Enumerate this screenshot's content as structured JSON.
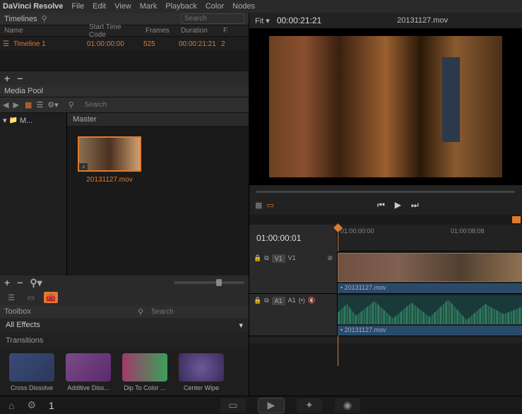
{
  "app_name": "DaVinci Resolve",
  "menu": [
    "File",
    "Edit",
    "View",
    "Mark",
    "Playback",
    "Color",
    "Nodes"
  ],
  "timelines_panel": {
    "title": "Timelines",
    "search_placeholder": "Search",
    "columns": {
      "name": "Name",
      "start": "Start Time Code",
      "frames": "Frames",
      "duration": "Duration",
      "extra": "F"
    },
    "row": {
      "name": "Timeline 1",
      "start": "01:00:00:00",
      "frames": "525",
      "duration": "00:00:21:21",
      "extra": "2"
    }
  },
  "media_pool": {
    "title": "Media Pool",
    "search_placeholder": "Search",
    "tree_root": "M...",
    "breadcrumb": "Master",
    "clip": {
      "name": "20131127.mov"
    }
  },
  "toolbox": {
    "title": "Toolbox",
    "search_placeholder": "Search",
    "filter_label": "All Effects",
    "section_label": "Transitions",
    "items": [
      "Cross Dissolve",
      "Additive Diss...",
      "Dip To Color ...",
      "Center Wipe"
    ]
  },
  "viewer": {
    "fit_label": "Fit",
    "timecode": "00:00:21:21",
    "clip_name": "20131127.mov"
  },
  "timeline": {
    "position_tc": "01:00:00:01",
    "ticks": [
      "01:00:00:00",
      "01:00:08:08"
    ],
    "video_track": {
      "badge": "V1",
      "label": "V1"
    },
    "audio_track": {
      "badge": "A1",
      "label": "A1"
    },
    "clip_name": "20131127.mov"
  },
  "footer": {
    "page": "1"
  }
}
